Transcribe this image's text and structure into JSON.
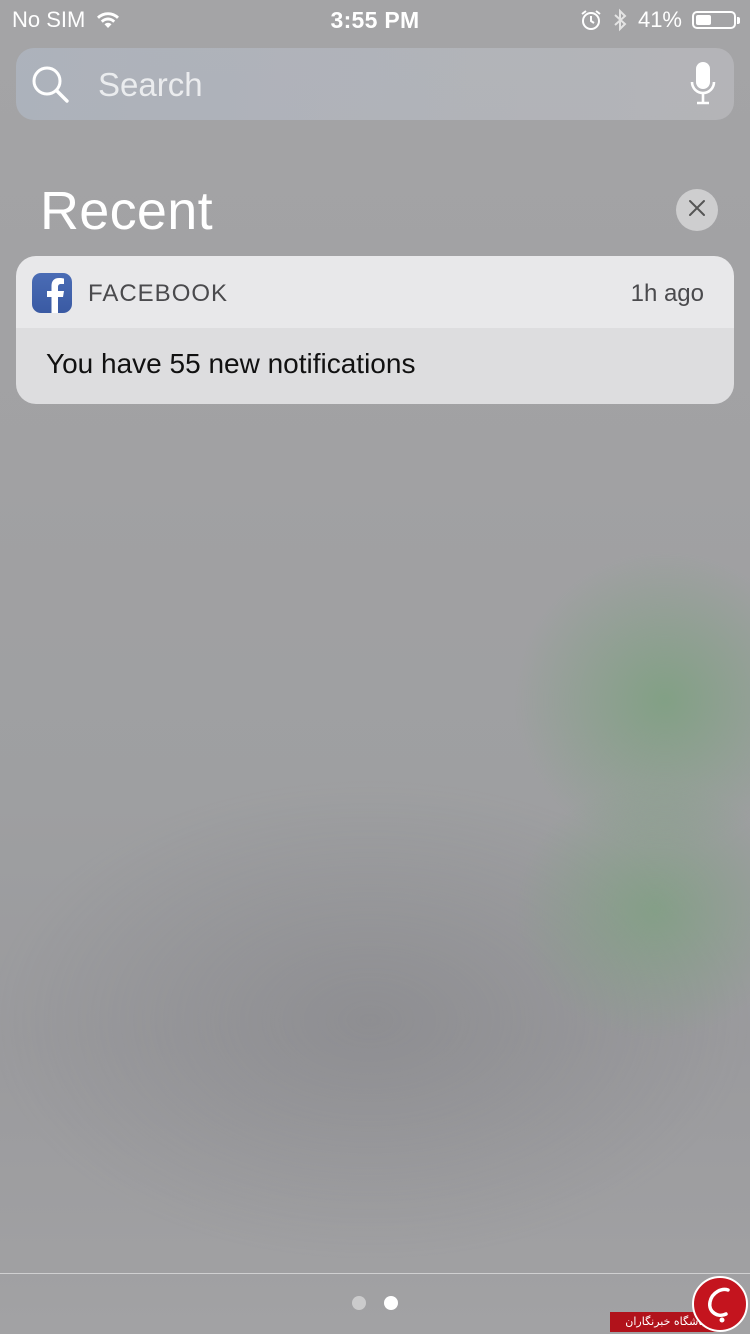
{
  "status_bar": {
    "carrier": "No SIM",
    "time": "3:55 PM",
    "battery_percent_label": "41%",
    "battery_level": 0.41,
    "icons": [
      "wifi-icon",
      "alarm-icon",
      "bluetooth-icon",
      "battery-icon"
    ]
  },
  "search": {
    "placeholder": "Search",
    "value": ""
  },
  "recent": {
    "title": "Recent"
  },
  "notification": {
    "app_name": "FACEBOOK",
    "time_ago": "1h ago",
    "message": "You have 55 new notifications",
    "app_icon": "facebook-icon",
    "brand_color": "#3b5998"
  },
  "page_indicator": {
    "count": 2,
    "active_index": 1
  },
  "watermark": {
    "text": "باشگاه خبرنگاران"
  }
}
